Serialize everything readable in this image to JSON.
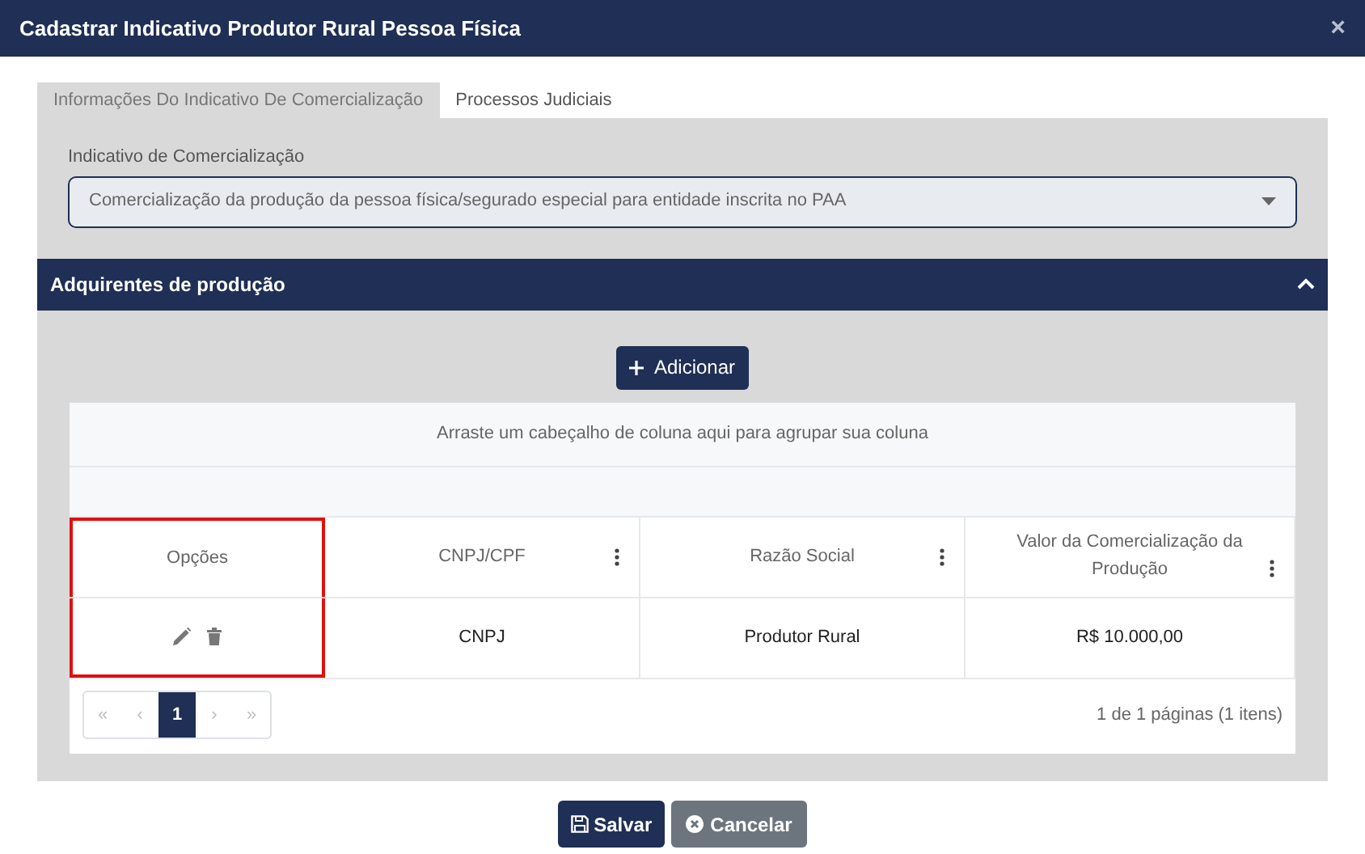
{
  "window": {
    "title": "Cadastrar Indicativo Produtor Rural Pessoa Física",
    "close": "×"
  },
  "tabs": [
    {
      "label": "Informações Do Indicativo De Comercialização",
      "selected": true
    },
    {
      "label": "Processos Judiciais",
      "selected": false
    }
  ],
  "indicativo": {
    "label": "Indicativo de Comercialização",
    "value": "Comercialização da produção da pessoa física/segurado especial para entidade inscrita no PAA"
  },
  "section": {
    "title": "Adquirentes de produção",
    "expanded": true
  },
  "add_button": "Adicionar",
  "grid": {
    "group_hint": "Arraste um cabeçalho de coluna aqui para agrupar sua coluna",
    "columns": [
      {
        "label": "Opções",
        "menu": false,
        "highlighted": true
      },
      {
        "label": "CNPJ/CPF",
        "menu": true,
        "highlighted": false
      },
      {
        "label": "Razão Social",
        "menu": true,
        "highlighted": false
      },
      {
        "label": "Valor da Comercialização da Produção",
        "menu": true,
        "highlighted": false
      }
    ],
    "rows": [
      {
        "cnpj_cpf": "CNPJ",
        "razao_social": "Produtor Rural",
        "valor": "R$ 10.000,00"
      }
    ],
    "pager": [
      {
        "label": "«",
        "selected": false
      },
      {
        "label": "‹",
        "selected": false
      },
      {
        "label": "1",
        "selected": true
      },
      {
        "label": "›",
        "selected": false
      },
      {
        "label": "»",
        "selected": false
      }
    ],
    "page_info": "1 de 1 páginas (1 itens)"
  },
  "buttons": [
    {
      "kind": "save",
      "label": "Salvar"
    },
    {
      "kind": "cancel",
      "label": "Cancelar"
    }
  ]
}
